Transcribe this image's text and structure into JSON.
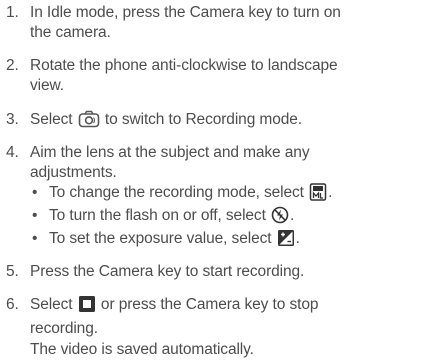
{
  "steps": [
    {
      "num": "1.",
      "line1": "In Idle mode, press the Camera key to turn on",
      "line2": "the camera."
    },
    {
      "num": "2.",
      "line1": "Rotate the phone anti-clockwise to landscape",
      "line2": "view."
    },
    {
      "num": "3.",
      "pre": "Select",
      "icon": "camera-switch-icon",
      "post": "to switch to Recording mode."
    },
    {
      "num": "4.",
      "line1": "Aim the lens at the subject and make any",
      "line2": "adjustments."
    },
    {
      "num": "5.",
      "line1": "Press the Camera key to start recording."
    },
    {
      "num": "6.",
      "pre": "Select",
      "icon": "stop-icon",
      "post": "or press the Camera key to stop",
      "line2": "recording."
    }
  ],
  "bullets": [
    {
      "text": "To change the recording mode, select",
      "icon": "recording-mode-icon"
    },
    {
      "text": "To turn the flash on or off, select",
      "icon": "flash-off-icon"
    },
    {
      "text": "To set the exposure value, select",
      "icon": "exposure-icon"
    }
  ],
  "bullet_char": "•",
  "end_period": ".",
  "note": "The video is saved automatically."
}
